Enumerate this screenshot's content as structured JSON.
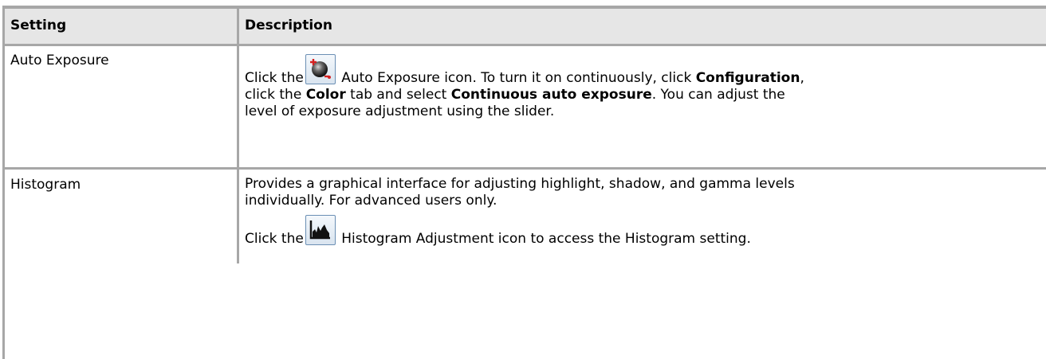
{
  "table": {
    "header": {
      "setting": "Setting",
      "description": "Description"
    },
    "rows": [
      {
        "setting": "Auto Exposure",
        "description": {
          "t1": "Click the",
          "t2": " Auto Exposure icon. To turn it on continuously, click ",
          "b1": "Configuration",
          "t3": ",",
          "t4": "click the ",
          "b2": "Color",
          "t5": " tab and select ",
          "b3": "Continuous auto exposure",
          "t6": ". You can adjust the",
          "t7": "level of exposure adjustment using the slider."
        },
        "icon": "auto-exposure-icon"
      },
      {
        "setting": "Histogram",
        "description": {
          "p1a": "Provides a graphical interface for adjusting highlight, shadow, and gamma levels",
          "p1b": "individually. For advanced users only.",
          "t1": "Click the",
          "t2": " Histogram Adjustment icon to access the Histogram setting."
        },
        "icon": "histogram-adjustment-icon"
      }
    ]
  },
  "colors": {
    "border": "#a7a7a7",
    "header_bg": "#e6e6e6",
    "icon_border": "#6b8fb4"
  }
}
